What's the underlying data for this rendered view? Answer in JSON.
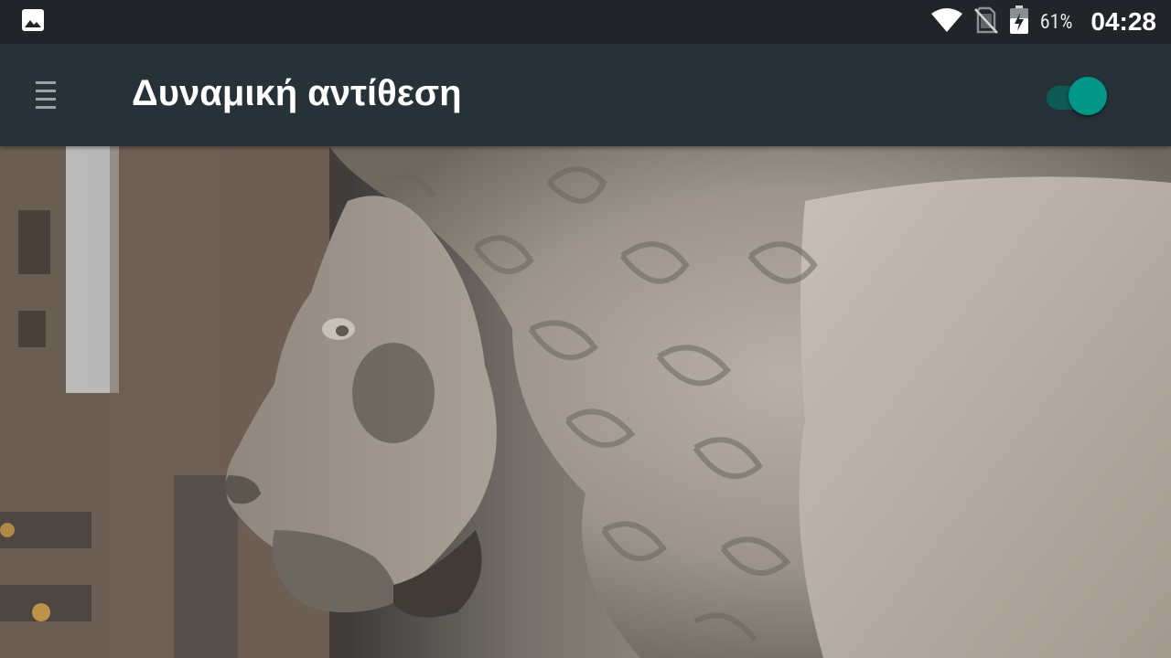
{
  "status_bar": {
    "left_icons": [
      "image-icon"
    ],
    "right_icons": [
      "wifi-icon",
      "no-sim-icon",
      "battery-charging-icon"
    ],
    "battery_percent": "61%",
    "time": "04:28"
  },
  "app_bar": {
    "menu_icon": "hamburger-menu-icon",
    "title": "Δυναμική αντίθεση",
    "toggle": {
      "on": true,
      "accent": "#009688"
    }
  },
  "colors": {
    "status_bar_bg": "#212529",
    "app_bar_bg": "#263238",
    "accent": "#009688"
  }
}
